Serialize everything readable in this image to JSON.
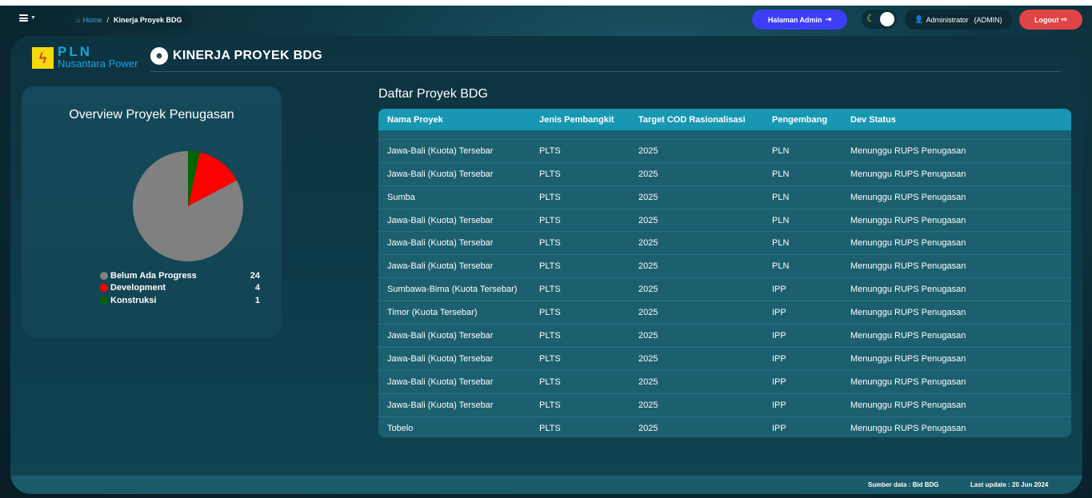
{
  "topbar": {
    "breadcrumb": {
      "home": "Home",
      "separator": "/",
      "current": "Kinerja Proyek BDG"
    },
    "admin_button": "Halaman Admin",
    "user_label": "Administrator",
    "user_role": "(ADMIN)",
    "logout_button": "Logout"
  },
  "header": {
    "logo_text": "PLN",
    "logo_subtext": "Nusantara Power",
    "page_title": "KINERJA PROYEK BDG"
  },
  "overview": {
    "title": "Overview Proyek Penugasan",
    "legend": [
      {
        "label": "Belum Ada Progress",
        "value": "24",
        "color": "#808080"
      },
      {
        "label": "Development",
        "value": "4",
        "color": "#ff0000"
      },
      {
        "label": "Konstruksi",
        "value": "1",
        "color": "#006400"
      }
    ]
  },
  "chart_data": {
    "type": "pie",
    "categories": [
      "Belum Ada Progress",
      "Development",
      "Konstruksi"
    ],
    "values": [
      24,
      4,
      1
    ],
    "colors": [
      "#808080",
      "#ff0000",
      "#006400"
    ],
    "title": "Overview Proyek Penugasan"
  },
  "table": {
    "title": "Daftar Proyek BDG",
    "columns": [
      "Nama Proyek",
      "Jenis Pembangkit",
      "Target COD Rasionalisasi",
      "Pengembang",
      "Dev Status"
    ],
    "rows": [
      [
        "Jawa-Bali (Kuota) Tersebar",
        "PLTS",
        "2025",
        "PLN",
        "Menunggu RUPS Penugasan"
      ],
      [
        "Jawa-Bali (Kuota) Tersebar",
        "PLTS",
        "2025",
        "PLN",
        "Menunggu RUPS Penugasan"
      ],
      [
        "Sumba",
        "PLTS",
        "2025",
        "PLN",
        "Menunggu RUPS Penugasan"
      ],
      [
        "Jawa-Bali (Kuota) Tersebar",
        "PLTS",
        "2025",
        "PLN",
        "Menunggu RUPS Penugasan"
      ],
      [
        "Jawa-Bali (Kuota) Tersebar",
        "PLTS",
        "2025",
        "PLN",
        "Menunggu RUPS Penugasan"
      ],
      [
        "Jawa-Bali (Kuota) Tersebar",
        "PLTS",
        "2025",
        "PLN",
        "Menunggu RUPS Penugasan"
      ],
      [
        "Sumbawa-Bima (Kuota Tersebar)",
        "PLTS",
        "2025",
        "IPP",
        "Menunggu RUPS Penugasan"
      ],
      [
        "Timor (Kuota Tersebar)",
        "PLTS",
        "2025",
        "IPP",
        "Menunggu RUPS Penugasan"
      ],
      [
        "Jawa-Bali (Kuota) Tersebar",
        "PLTS",
        "2025",
        "IPP",
        "Menunggu RUPS Penugasan"
      ],
      [
        "Jawa-Bali (Kuota) Tersebar",
        "PLTS",
        "2025",
        "IPP",
        "Menunggu RUPS Penugasan"
      ],
      [
        "Jawa-Bali (Kuota) Tersebar",
        "PLTS",
        "2025",
        "IPP",
        "Menunggu RUPS Penugasan"
      ],
      [
        "Jawa-Bali (Kuota) Tersebar",
        "PLTS",
        "2025",
        "IPP",
        "Menunggu RUPS Penugasan"
      ],
      [
        "Tobelo",
        "PLTS",
        "2025",
        "IPP",
        "Menunggu RUPS Penugasan"
      ]
    ]
  },
  "footer": {
    "source_label": "Sumber data :",
    "source_value": "Bid BDG",
    "update_label": "Last update :",
    "update_value": "20 Jun 2024"
  }
}
